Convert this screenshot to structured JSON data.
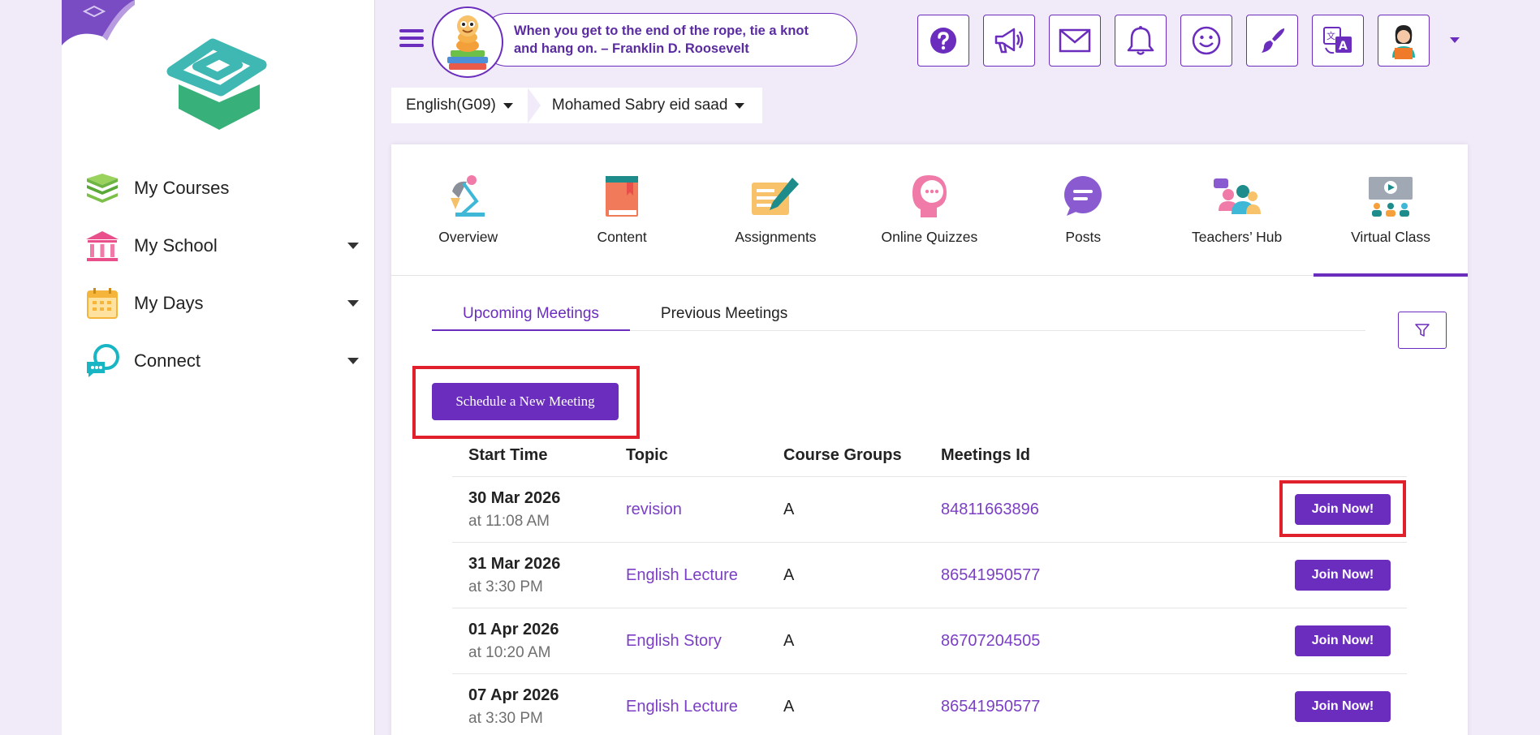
{
  "colors": {
    "accent": "#6a2dbd",
    "highlight": "#e0202a",
    "link": "#7b3fc4",
    "background": "#f1eaf8"
  },
  "sidebar": {
    "items": [
      {
        "label": "My Courses",
        "icon": "books-icon",
        "has_caret": false
      },
      {
        "label": "My School",
        "icon": "school-building-icon",
        "has_caret": true
      },
      {
        "label": "My Days",
        "icon": "calendar-icon",
        "has_caret": true
      },
      {
        "label": "Connect",
        "icon": "chat-bubbles-icon",
        "has_caret": true
      }
    ]
  },
  "header": {
    "quote_line1": "When you get to the end of the rope, tie a knot",
    "quote_line2": "and hang on. – Franklin D. Roosevelt",
    "icons": [
      "help-icon",
      "announcement-icon",
      "mail-icon",
      "bell-icon",
      "smiley-icon",
      "paint-brush-icon",
      "translate-icon",
      "profile-avatar-icon"
    ]
  },
  "breadcrumb": {
    "course": "English(G09)",
    "teacher": "Mohamed Sabry eid saad"
  },
  "tools": [
    {
      "label": "Overview",
      "icon": "desk-lamp-icon"
    },
    {
      "label": "Content",
      "icon": "book-icon"
    },
    {
      "label": "Assignments",
      "icon": "assignment-pen-icon"
    },
    {
      "label": "Online Quizzes",
      "icon": "head-thinking-icon"
    },
    {
      "label": "Posts",
      "icon": "speech-bubble-icon"
    },
    {
      "label": "Teachers’ Hub",
      "icon": "teachers-group-icon"
    },
    {
      "label": "Virtual Class",
      "icon": "virtual-classroom-icon"
    }
  ],
  "subtabs": {
    "upcoming": "Upcoming Meetings",
    "previous": "Previous Meetings"
  },
  "schedule_button": "Schedule a New Meeting",
  "table": {
    "headers": [
      "Start Time",
      "Topic",
      "Course Groups",
      "Meetings Id"
    ],
    "join_label": "Join Now!",
    "rows": [
      {
        "date": "30 Mar 2026",
        "time": "at 11:08 AM",
        "topic": "revision",
        "group": "A",
        "meeting_id": "84811663896"
      },
      {
        "date": "31 Mar 2026",
        "time": "at 3:30 PM",
        "topic": "English Lecture",
        "group": "A",
        "meeting_id": "86541950577"
      },
      {
        "date": "01 Apr 2026",
        "time": "at 10:20 AM",
        "topic": "English Story",
        "group": "A",
        "meeting_id": "86707204505"
      },
      {
        "date": "07 Apr 2026",
        "time": "at 3:30 PM",
        "topic": "English Lecture",
        "group": "A",
        "meeting_id": "86541950577"
      }
    ]
  }
}
